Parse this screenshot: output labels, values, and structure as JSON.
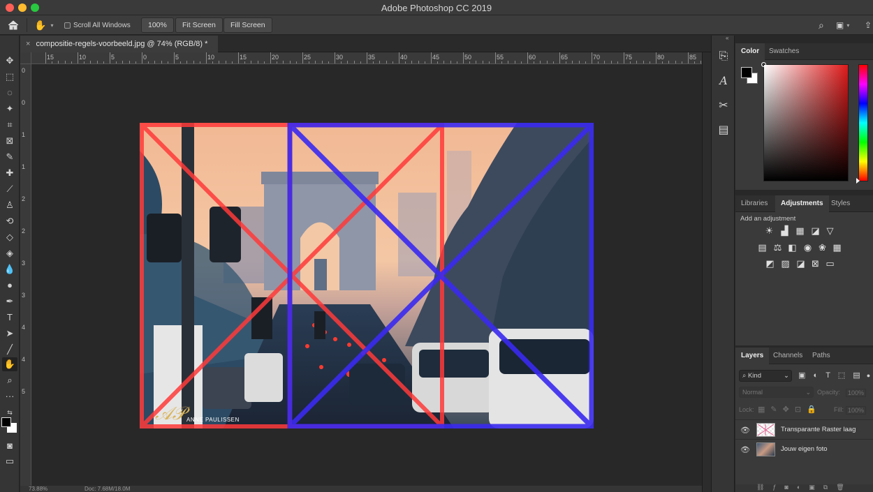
{
  "window": {
    "title": "Adobe Photoshop CC 2019"
  },
  "options_bar": {
    "scroll_all_label": "Scroll All Windows",
    "zoom_button": "100%",
    "fit_screen_button": "Fit Screen",
    "fill_screen_button": "Fill Screen"
  },
  "document": {
    "tab_title": "compositie-regels-voorbeeld.jpg @ 74% (RGB/8) *",
    "close_glyph": "×",
    "watermark": "ANNE PAULISSEN"
  },
  "ruler": {
    "top_labels": [
      "15",
      "10",
      "5",
      "0",
      "5",
      "10",
      "15",
      "20",
      "25",
      "30",
      "35",
      "40",
      "45",
      "50",
      "55",
      "60",
      "65",
      "70",
      "75",
      "80",
      "85"
    ],
    "left_labels": [
      "0",
      "0",
      "1",
      "1",
      "2",
      "2",
      "3",
      "3",
      "4",
      "4",
      "5"
    ]
  },
  "status": {
    "zoom": "73.88%",
    "doc": "Doc: 7.68M/18.0M"
  },
  "color_panel": {
    "tabs": [
      "Color",
      "Swatches"
    ],
    "active_tab": "Color",
    "foreground": "#000000",
    "background": "#ffffff",
    "picker_hue": "#e01a1a"
  },
  "adjustments_panel": {
    "tabs": [
      "Libraries",
      "Adjustments",
      "Styles"
    ],
    "active_tab": "Adjustments",
    "caption": "Add an adjustment"
  },
  "layers_panel": {
    "tabs": [
      "Layers",
      "Channels",
      "Paths"
    ],
    "active_tab": "Layers",
    "filter_kind": "Kind",
    "blend_mode": "Normal",
    "opacity_label": "Opacity:",
    "opacity_value": "100%",
    "lock_label": "Lock:",
    "fill_label": "Fill:",
    "fill_value": "100%",
    "layers": [
      {
        "name": "Transparante Raster laag",
        "visible": true
      },
      {
        "name": "Jouw eigen foto",
        "visible": true
      }
    ]
  },
  "colors": {
    "red_grid": "#ff3a3a",
    "blue_grid": "#3a2af0",
    "accent": "#2d7ff9"
  }
}
